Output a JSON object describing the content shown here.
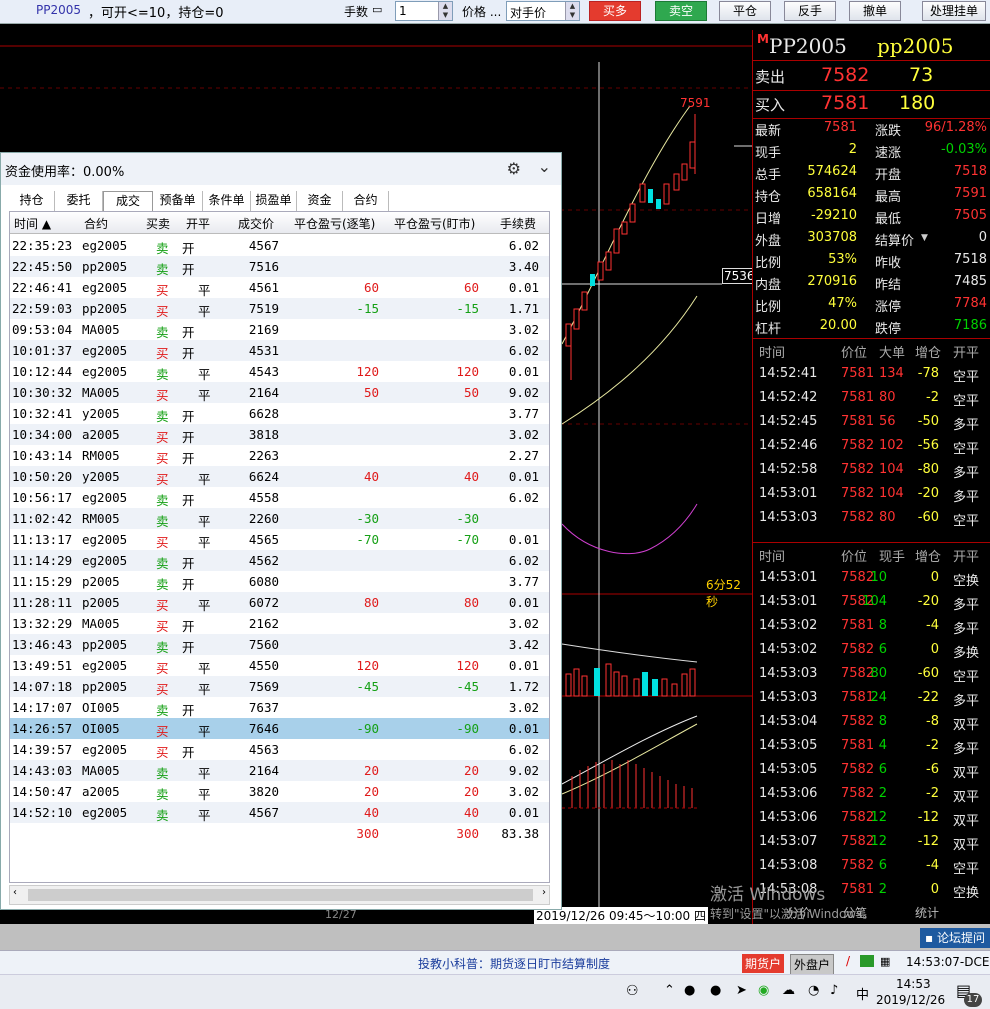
{
  "topbar": {
    "symbol": "PP2005",
    "info": "，可开<=10，持仓=0",
    "qty_label": "手数",
    "qty_value": "1",
    "price_label": "价格 ...",
    "price_value": "对手价",
    "buy_btn": "买多",
    "sell_btn": "卖空",
    "close_btn": "平仓",
    "reverse_btn": "反手",
    "cancel_btn": "撤单",
    "pending_btn": "处理挂单"
  },
  "chart": {
    "high_price": "7591",
    "cross_price": "7536",
    "countdown": "6分52秒",
    "time_label": "2019/12/26 09:45～10:00 四",
    "date_label": "12/27"
  },
  "quote": {
    "code": "PP2005",
    "name": "pp2005",
    "ask_label": "卖出",
    "ask_price": "7582",
    "ask_vol": "73",
    "bid_label": "买入",
    "bid_price": "7581",
    "bid_vol": "180",
    "rows": [
      [
        "最新",
        "7581",
        "涨跌",
        "96/1.28%"
      ],
      [
        "现手",
        "2",
        "速涨",
        "-0.03%"
      ],
      [
        "总手",
        "574624",
        "开盘",
        "7518"
      ],
      [
        "持仓",
        "658164",
        "最高",
        "7591"
      ],
      [
        "日增",
        "-29210",
        "最低",
        "7505"
      ],
      [
        "外盘",
        "303708",
        "结算价",
        "0"
      ],
      [
        "比例",
        "53%",
        "昨收",
        "7518"
      ],
      [
        "内盘",
        "270916",
        "昨结",
        "7485"
      ],
      [
        "比例",
        "47%",
        "涨停",
        "7784"
      ],
      [
        "杠杆",
        "20.00",
        "跌停",
        "7186"
      ]
    ],
    "tick1_headers": [
      "时间",
      "价位",
      "大单",
      "增仓",
      "开平"
    ],
    "tick1": [
      [
        "14:52:41",
        "7581",
        "134",
        "-78",
        "空平"
      ],
      [
        "14:52:42",
        "7581",
        "80",
        "-2",
        "空平"
      ],
      [
        "14:52:45",
        "7581",
        "56",
        "-50",
        "多平"
      ],
      [
        "14:52:46",
        "7582",
        "102",
        "-56",
        "空平"
      ],
      [
        "14:52:58",
        "7582",
        "104",
        "-80",
        "多平"
      ],
      [
        "14:53:01",
        "7582",
        "104",
        "-20",
        "多平"
      ],
      [
        "14:53:03",
        "7582",
        "80",
        "-60",
        "空平"
      ]
    ],
    "tick2_headers": [
      "时间",
      "价位",
      "现手",
      "增仓",
      "开平"
    ],
    "tick2": [
      [
        "14:53:01",
        "7582",
        "10",
        "0",
        "空换"
      ],
      [
        "14:53:01",
        "7582",
        "104",
        "-20",
        "多平"
      ],
      [
        "14:53:02",
        "7581",
        "8",
        "-4",
        "多平"
      ],
      [
        "14:53:02",
        "7582",
        "6",
        "0",
        "多换"
      ],
      [
        "14:53:03",
        "7582",
        "80",
        "-60",
        "空平"
      ],
      [
        "14:53:03",
        "7581",
        "24",
        "-22",
        "多平"
      ],
      [
        "14:53:04",
        "7582",
        "8",
        "-8",
        "双平"
      ],
      [
        "14:53:05",
        "7581",
        "4",
        "-2",
        "多平"
      ],
      [
        "14:53:05",
        "7582",
        "6",
        "-6",
        "双平"
      ],
      [
        "14:53:06",
        "7582",
        "2",
        "-2",
        "双平"
      ],
      [
        "14:53:06",
        "7582",
        "12",
        "-12",
        "双平"
      ],
      [
        "14:53:07",
        "7582",
        "12",
        "-12",
        "双平"
      ],
      [
        "14:53:08",
        "7582",
        "6",
        "-4",
        "空平"
      ],
      [
        "14:53:08",
        "7581",
        "2",
        "0",
        "空换"
      ]
    ],
    "bottom_tabs": [
      "分价",
      "分笔",
      "统计"
    ]
  },
  "fund": {
    "title": "资金使用率：0.00%",
    "tabs": [
      "持仓",
      "委托",
      "成交",
      "预备单",
      "条件单",
      "损盈单",
      "资金",
      "合约"
    ],
    "active_tab": "成交",
    "headers": [
      "时间 ▲",
      "合约",
      "买卖",
      "开平",
      "成交价",
      "平仓盈亏(逐笔)",
      "平仓盈亏(盯市)",
      "手续费"
    ],
    "rows": [
      [
        "22:35:23",
        "eg2005",
        "卖",
        "开",
        "4567",
        "",
        "",
        "6.02"
      ],
      [
        "22:45:50",
        "pp2005",
        "卖",
        "开",
        "7516",
        "",
        "",
        "3.40"
      ],
      [
        "22:46:41",
        "eg2005",
        "买",
        "平",
        "4561",
        "60",
        "60",
        "0.01"
      ],
      [
        "22:59:03",
        "pp2005",
        "买",
        "平",
        "7519",
        "-15",
        "-15",
        "1.71"
      ],
      [
        "09:53:04",
        "MA005",
        "卖",
        "开",
        "2169",
        "",
        "",
        "3.02"
      ],
      [
        "10:01:37",
        "eg2005",
        "买",
        "开",
        "4531",
        "",
        "",
        "6.02"
      ],
      [
        "10:12:44",
        "eg2005",
        "卖",
        "平",
        "4543",
        "120",
        "120",
        "0.01"
      ],
      [
        "10:30:32",
        "MA005",
        "买",
        "平",
        "2164",
        "50",
        "50",
        "9.02"
      ],
      [
        "10:32:41",
        "y2005",
        "卖",
        "开",
        "6628",
        "",
        "",
        "3.77"
      ],
      [
        "10:34:00",
        "a2005",
        "买",
        "开",
        "3818",
        "",
        "",
        "3.02"
      ],
      [
        "10:43:14",
        "RM005",
        "买",
        "开",
        "2263",
        "",
        "",
        "2.27"
      ],
      [
        "10:50:20",
        "y2005",
        "买",
        "平",
        "6624",
        "40",
        "40",
        "0.01"
      ],
      [
        "10:56:17",
        "eg2005",
        "卖",
        "开",
        "4558",
        "",
        "",
        "6.02"
      ],
      [
        "11:02:42",
        "RM005",
        "卖",
        "平",
        "2260",
        "-30",
        "-30",
        ""
      ],
      [
        "11:13:17",
        "eg2005",
        "买",
        "平",
        "4565",
        "-70",
        "-70",
        "0.01"
      ],
      [
        "11:14:29",
        "eg2005",
        "卖",
        "开",
        "4562",
        "",
        "",
        "6.02"
      ],
      [
        "11:15:29",
        "p2005",
        "卖",
        "开",
        "6080",
        "",
        "",
        "3.77"
      ],
      [
        "11:28:11",
        "p2005",
        "买",
        "平",
        "6072",
        "80",
        "80",
        "0.01"
      ],
      [
        "13:32:29",
        "MA005",
        "买",
        "开",
        "2162",
        "",
        "",
        "3.02"
      ],
      [
        "13:46:43",
        "pp2005",
        "卖",
        "开",
        "7560",
        "",
        "",
        "3.42"
      ],
      [
        "13:49:51",
        "eg2005",
        "买",
        "平",
        "4550",
        "120",
        "120",
        "0.01"
      ],
      [
        "14:07:18",
        "pp2005",
        "买",
        "平",
        "7569",
        "-45",
        "-45",
        "1.72"
      ],
      [
        "14:17:07",
        "OI005",
        "卖",
        "开",
        "7637",
        "",
        "",
        "3.02"
      ],
      [
        "14:26:57",
        "OI005",
        "买",
        "平",
        "7646",
        "-90",
        "-90",
        "0.01"
      ],
      [
        "14:39:57",
        "eg2005",
        "买",
        "开",
        "4563",
        "",
        "",
        "6.02"
      ],
      [
        "14:43:03",
        "MA005",
        "卖",
        "平",
        "2164",
        "20",
        "20",
        "9.02"
      ],
      [
        "14:50:47",
        "a2005",
        "卖",
        "平",
        "3820",
        "20",
        "20",
        "3.02"
      ],
      [
        "14:52:10",
        "eg2005",
        "卖",
        "平",
        "4567",
        "40",
        "40",
        "0.01"
      ]
    ],
    "total": [
      "",
      "",
      "",
      "",
      "",
      "300",
      "300",
      "83.38"
    ],
    "selected_row": 23
  },
  "statusbar": {
    "science": "投教小科普：期货逐日盯市结算制度",
    "futures_acct": "期货户",
    "outer_acct": "外盘户",
    "clock": "14:53:07-DCE",
    "forum": "论坛提问"
  },
  "taskbar": {
    "ime": "中",
    "time": "14:53",
    "date": "2019/12/26",
    "badge": "17"
  },
  "watermark": {
    "line1": "激活 Windows",
    "line2": "转到\"设置\"以激活 Windows。"
  },
  "colors": {
    "buy": "#e43b2e",
    "sell": "#2fa84f",
    "up": "#ff3232",
    "down": "#00d200"
  }
}
